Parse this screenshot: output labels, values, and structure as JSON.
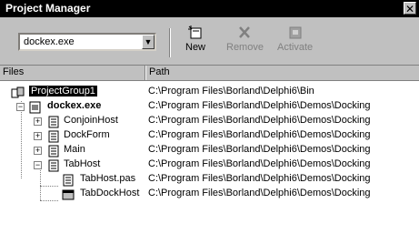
{
  "window": {
    "title": "Project Manager",
    "close_glyph": "✕"
  },
  "toolbar": {
    "project_select": "dockex.exe",
    "dropdown_glyph": "▼",
    "new_label": "New",
    "remove_label": "Remove",
    "activate_label": "Activate"
  },
  "columns": {
    "files": "Files",
    "path": "Path"
  },
  "tree": [
    {
      "name": "ProjectGroup1",
      "path": "C:\\Program Files\\Borland\\Delphi6\\Bin"
    },
    {
      "name": "dockex.exe",
      "path": "C:\\Program Files\\Borland\\Delphi6\\Demos\\Docking"
    },
    {
      "name": "ConjoinHost",
      "path": "C:\\Program Files\\Borland\\Delphi6\\Demos\\Docking"
    },
    {
      "name": "DockForm",
      "path": "C:\\Program Files\\Borland\\Delphi6\\Demos\\Docking"
    },
    {
      "name": "Main",
      "path": "C:\\Program Files\\Borland\\Delphi6\\Demos\\Docking"
    },
    {
      "name": "TabHost",
      "path": "C:\\Program Files\\Borland\\Delphi6\\Demos\\Docking"
    },
    {
      "name": "TabHost.pas",
      "path": "C:\\Program Files\\Borland\\Delphi6\\Demos\\Docking"
    },
    {
      "name": "TabDockHost",
      "path": "C:\\Program Files\\Borland\\Delphi6\\Demos\\Docking"
    }
  ],
  "expanders": {
    "plus": "+",
    "minus": "−"
  },
  "icons": {
    "group": "project-group-icon",
    "project": "project-icon",
    "unit": "unit-icon",
    "form": "form-icon",
    "new": "new-icon",
    "remove": "remove-icon",
    "activate": "activate-icon"
  }
}
